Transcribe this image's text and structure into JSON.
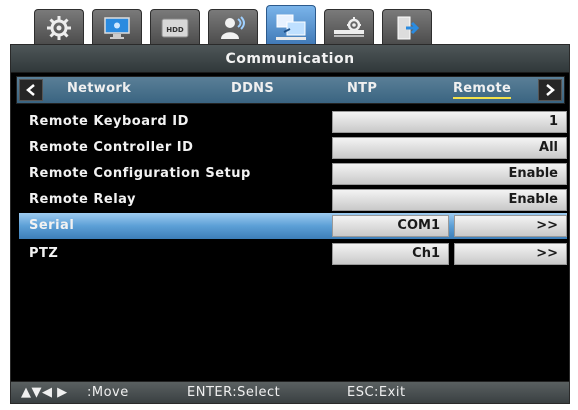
{
  "top_tabs": [
    {
      "name": "settings-icon",
      "active": false
    },
    {
      "name": "display-icon",
      "active": false
    },
    {
      "name": "hdd-icon",
      "active": false,
      "text": "HDD"
    },
    {
      "name": "user-icon",
      "active": false
    },
    {
      "name": "communication-icon",
      "active": true
    },
    {
      "name": "system-icon",
      "active": false
    },
    {
      "name": "exit-icon",
      "active": false
    }
  ],
  "window": {
    "title": "Communication"
  },
  "subtabs": [
    {
      "label": "Network",
      "active": false
    },
    {
      "label": "DDNS",
      "active": false
    },
    {
      "label": "NTP",
      "active": false
    },
    {
      "label": "Remote",
      "active": true
    }
  ],
  "rows": [
    {
      "label": "Remote Keyboard ID",
      "value": "1"
    },
    {
      "label": "Remote Controller ID",
      "value": "All"
    },
    {
      "label": "Remote Configuration Setup",
      "value": "Enable"
    },
    {
      "label": "Remote Relay",
      "value": "Enable"
    },
    {
      "label": "Serial",
      "value": "COM1",
      "value2": ">>",
      "selected": true
    },
    {
      "label": "PTZ",
      "value": "Ch1",
      "value2": ">>"
    }
  ],
  "status": {
    "move": ":Move",
    "select": "ENTER:Select",
    "exit": "ESC:Exit"
  },
  "colors": {
    "accent_blue": "#3d76b4",
    "subtab_underline": "#f5e24a",
    "selected_row": "#5c9fd6"
  }
}
